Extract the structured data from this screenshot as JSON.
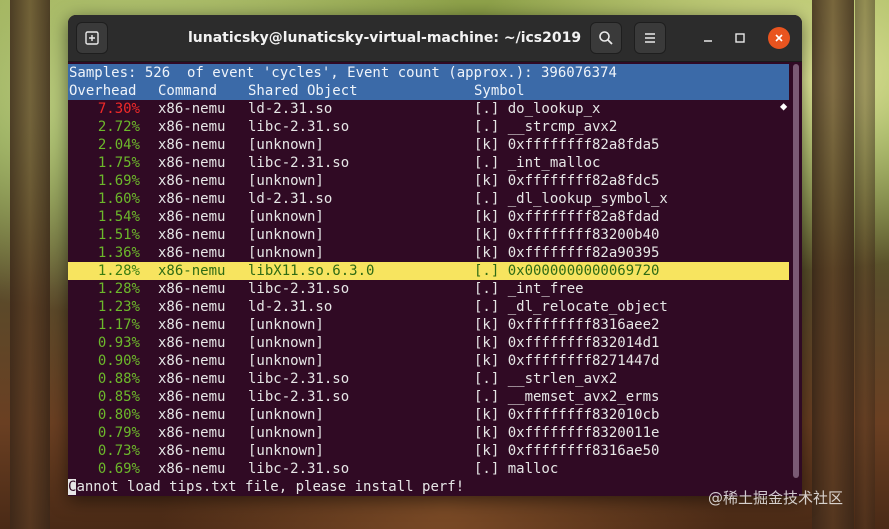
{
  "window": {
    "title": "lunaticsky@lunaticsky-virtual-machine: ~/ics2019",
    "icons": {
      "new_tab": "new-tab-icon",
      "search": "search-icon",
      "menu": "hamburger-menu-icon",
      "minimize": "minimize-icon",
      "maximize": "maximize-icon",
      "close": "close-icon"
    },
    "colors": {
      "terminal_bg": "#300a24",
      "header_bg": "#3b6aa8",
      "selected_bg": "#f7e45f",
      "overhead_green": "#6cb82b",
      "overhead_red": "#ef2929",
      "close_button": "#e9541f"
    }
  },
  "perf": {
    "summary": "Samples: 526  of event 'cycles', Event count (approx.): 396076374",
    "columns": {
      "overhead": "Overhead",
      "command": "Command",
      "shared_object": "Shared Object",
      "symbol": "Symbol"
    },
    "selected_index": 9,
    "rows": [
      {
        "overhead": "7.30%",
        "command": "x86-nemu",
        "object": "ld-2.31.so",
        "symbol": "[.] do_lookup_x",
        "hot": true
      },
      {
        "overhead": "2.72%",
        "command": "x86-nemu",
        "object": "libc-2.31.so",
        "symbol": "[.] __strcmp_avx2"
      },
      {
        "overhead": "2.04%",
        "command": "x86-nemu",
        "object": "[unknown]",
        "symbol": "[k] 0xffffffff82a8fda5"
      },
      {
        "overhead": "1.75%",
        "command": "x86-nemu",
        "object": "libc-2.31.so",
        "symbol": "[.] _int_malloc"
      },
      {
        "overhead": "1.69%",
        "command": "x86-nemu",
        "object": "[unknown]",
        "symbol": "[k] 0xffffffff82a8fdc5"
      },
      {
        "overhead": "1.60%",
        "command": "x86-nemu",
        "object": "ld-2.31.so",
        "symbol": "[.] _dl_lookup_symbol_x"
      },
      {
        "overhead": "1.54%",
        "command": "x86-nemu",
        "object": "[unknown]",
        "symbol": "[k] 0xffffffff82a8fdad"
      },
      {
        "overhead": "1.51%",
        "command": "x86-nemu",
        "object": "[unknown]",
        "symbol": "[k] 0xffffffff83200b40"
      },
      {
        "overhead": "1.36%",
        "command": "x86-nemu",
        "object": "[unknown]",
        "symbol": "[k] 0xffffffff82a90395"
      },
      {
        "overhead": "1.28%",
        "command": "x86-nemu",
        "object": "libX11.so.6.3.0",
        "symbol": "[.] 0x0000000000069720"
      },
      {
        "overhead": "1.28%",
        "command": "x86-nemu",
        "object": "libc-2.31.so",
        "symbol": "[.] _int_free"
      },
      {
        "overhead": "1.23%",
        "command": "x86-nemu",
        "object": "ld-2.31.so",
        "symbol": "[.] _dl_relocate_object"
      },
      {
        "overhead": "1.17%",
        "command": "x86-nemu",
        "object": "[unknown]",
        "symbol": "[k] 0xffffffff8316aee2"
      },
      {
        "overhead": "0.93%",
        "command": "x86-nemu",
        "object": "[unknown]",
        "symbol": "[k] 0xffffffff832014d1"
      },
      {
        "overhead": "0.90%",
        "command": "x86-nemu",
        "object": "[unknown]",
        "symbol": "[k] 0xffffffff8271447d"
      },
      {
        "overhead": "0.88%",
        "command": "x86-nemu",
        "object": "libc-2.31.so",
        "symbol": "[.] __strlen_avx2"
      },
      {
        "overhead": "0.85%",
        "command": "x86-nemu",
        "object": "libc-2.31.so",
        "symbol": "[.] __memset_avx2_erms"
      },
      {
        "overhead": "0.80%",
        "command": "x86-nemu",
        "object": "[unknown]",
        "symbol": "[k] 0xffffffff832010cb"
      },
      {
        "overhead": "0.79%",
        "command": "x86-nemu",
        "object": "[unknown]",
        "symbol": "[k] 0xffffffff8320011e"
      },
      {
        "overhead": "0.73%",
        "command": "x86-nemu",
        "object": "[unknown]",
        "symbol": "[k] 0xffffffff8316ae50"
      },
      {
        "overhead": "0.69%",
        "command": "x86-nemu",
        "object": "libc-2.31.so",
        "symbol": "[.] malloc"
      }
    ],
    "status_first_char": "C",
    "status_rest": "annot load tips.txt file, please install perf!"
  },
  "watermark": "@稀土掘金技术社区"
}
